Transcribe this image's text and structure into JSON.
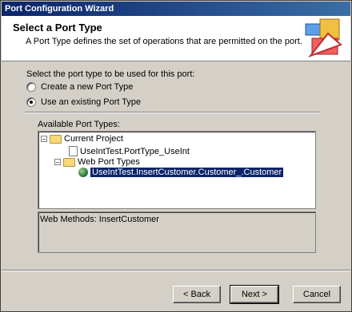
{
  "window": {
    "title": "Port Configuration Wizard"
  },
  "banner": {
    "title": "Select a Port Type",
    "description": "A Port Type defines the set of operations that are permitted on the port.",
    "icon": "wizard-port-icon"
  },
  "form": {
    "prompt": "Select the port type to be used for this port:",
    "options": [
      {
        "label": "Create a new Port Type",
        "checked": false
      },
      {
        "label": "Use an existing Port Type",
        "checked": true
      }
    ]
  },
  "tree": {
    "label": "Available Port Types:",
    "nodes": [
      {
        "label": "Current Project",
        "toggle": "−"
      },
      {
        "label": "UseIntTest.PortType_UseInt"
      },
      {
        "label": "Web Port Types",
        "toggle": "−"
      },
      {
        "label": "UseIntTest.InsertCustomer.Customer_.Customer",
        "selected": true
      }
    ]
  },
  "methods": {
    "text": "Web Methods: InsertCustomer"
  },
  "buttons": {
    "back": "< Back",
    "next": "Next >",
    "cancel": "Cancel"
  }
}
